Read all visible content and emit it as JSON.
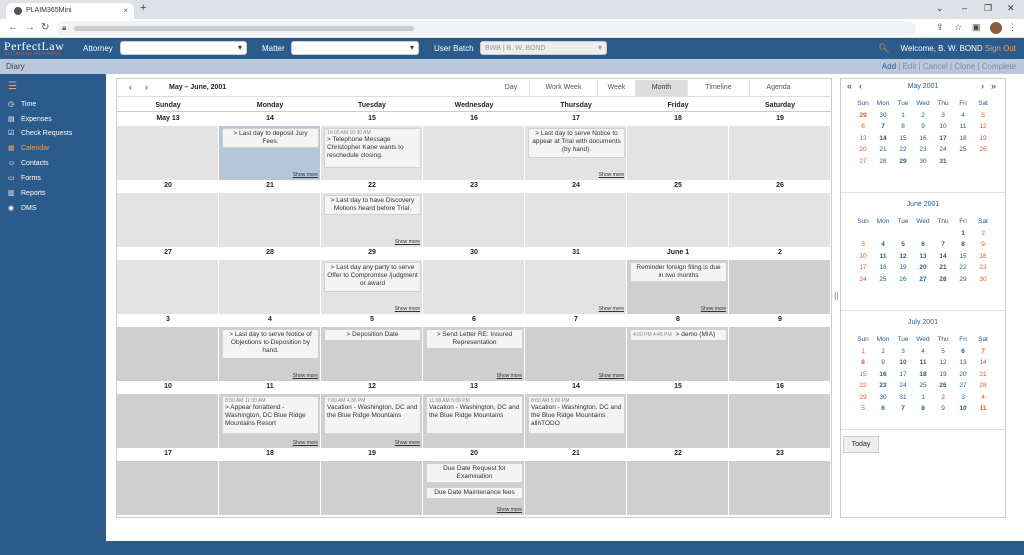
{
  "browser": {
    "tab_title": "PLAIM365Mini",
    "new_tab": "+",
    "close": "×"
  },
  "header": {
    "logo_main": "PerfectLaw",
    "logo_sub": "ALL-IN-ONE SOFTWARE",
    "attorney_label": "Attorney",
    "matter_label": "Matter",
    "user_batch_label": "User Batch",
    "user_batch_value": "BWB | B. W. BOND",
    "welcome": "Welcome, B. W. BOND",
    "sign_out": "Sign Out"
  },
  "subbar": {
    "title": "Diary",
    "actions": [
      "Add",
      "Edit",
      "Cancel",
      "Clone",
      "Complete"
    ]
  },
  "sidebar": {
    "items": [
      {
        "label": "Time",
        "icon": "clock-icon"
      },
      {
        "label": "Expenses",
        "icon": "expenses-icon"
      },
      {
        "label": "Check Requests",
        "icon": "check-icon"
      },
      {
        "label": "Calendar",
        "icon": "calendar-icon",
        "active": true
      },
      {
        "label": "Contacts",
        "icon": "contacts-icon"
      },
      {
        "label": "Forms",
        "icon": "forms-icon"
      },
      {
        "label": "Reports",
        "icon": "reports-icon"
      },
      {
        "label": "DMS",
        "icon": "dms-icon"
      }
    ]
  },
  "calendar": {
    "range": "May – June, 2001",
    "views": [
      "Day",
      "Work Week",
      "Week",
      "Month",
      "Timeline",
      "Agenda"
    ],
    "selected_view": "Month",
    "weekdays": [
      "Sunday",
      "Monday",
      "Tuesday",
      "Wednesday",
      "Thursday",
      "Friday",
      "Saturday"
    ],
    "show_more": "Show more",
    "weeks": [
      {
        "days": [
          "May 13",
          "14",
          "15",
          "16",
          "17",
          "18",
          "19"
        ]
      },
      {
        "days": [
          "20",
          "21",
          "22",
          "23",
          "24",
          "25",
          "26"
        ]
      },
      {
        "days": [
          "27",
          "28",
          "29",
          "30",
          "31",
          "June 1",
          "2"
        ]
      },
      {
        "days": [
          "3",
          "4",
          "5",
          "6",
          "7",
          "8",
          "9"
        ]
      },
      {
        "days": [
          "10",
          "11",
          "12",
          "13",
          "14",
          "15",
          "16"
        ]
      },
      {
        "days": [
          "17",
          "18",
          "19",
          "20",
          "21",
          "22",
          "23"
        ]
      }
    ],
    "events": {
      "w0d1": "> Last day to deposit Jury Fees.",
      "w0d2_time": "10:00 AM  10:30 AM",
      "w0d2": "> Telephone Message Christopher Kane wants to reschedule closing.",
      "w0d4": "> Last day to serve Notice to appear at Trial with documents (by hand).",
      "w1d2": "> Last day to have Discovery Motions heard before Trial.",
      "w2d2": "> Last day any party to serve Offer to Compromise /judgment or award",
      "w2d5": "Reminder foreign filing is due in two months",
      "w3d1": "> Last day to serve Notice of Objections to Deposition by hand.",
      "w3d2": "> Deposition Date",
      "w3d3": "> Send Letter RE: Insured Representation",
      "w3d5_time": "4:00 PM  4:45 PM",
      "w3d5": "> demo (MIA)",
      "w4d1_time": "8:00 AM  11:00 AM",
      "w4d1": "> Appear for/attend - Washington, DC Blue Ridge Mountains Resort",
      "w4d2_time": "7:00 AM  4:30 PM",
      "w4d2": "Vacation - Washington, DC and the Blue Ridge Mountains",
      "w4d3_time": "11:00 AM  5:00 PM",
      "w4d3": "Vacation - Washington, DC and the Blue Ridge Mountains",
      "w4d4_time": "8:00 AM  5:00 PM",
      "w4d4": "Vacation - Washington, DC and the Blue Ridge Mountains allhTODO",
      "w5d3a": "Due Date Request for Examination",
      "w5d3b": "Due Date Maintenance fees"
    }
  },
  "mini_calendars": {
    "weekdays": [
      "Sun",
      "Mon",
      "Tue",
      "Wed",
      "Thu",
      "Fri",
      "Sat"
    ],
    "today_label": "Today",
    "nav": {
      "prev_year": "«",
      "prev": "‹",
      "next": "›",
      "next_year": "»"
    },
    "months": [
      {
        "title": "May 2001",
        "rows": [
          [
            "29",
            "30",
            "1",
            "2",
            "3",
            "4",
            "5"
          ],
          [
            "6",
            "7",
            "8",
            "9",
            "10",
            "11",
            "12"
          ],
          [
            "13",
            "14",
            "15",
            "16",
            "17",
            "18",
            "19"
          ],
          [
            "20",
            "21",
            "22",
            "23",
            "24",
            "25",
            "26"
          ],
          [
            "27",
            "28",
            "29",
            "30",
            "31",
            "",
            ""
          ]
        ]
      },
      {
        "title": "June 2001",
        "rows": [
          [
            "",
            "",
            "",
            "",
            "",
            "1",
            "2"
          ],
          [
            "3",
            "4",
            "5",
            "6",
            "7",
            "8",
            "9"
          ],
          [
            "10",
            "11",
            "12",
            "13",
            "14",
            "15",
            "16"
          ],
          [
            "17",
            "18",
            "19",
            "20",
            "21",
            "22",
            "23"
          ],
          [
            "24",
            "25",
            "26",
            "27",
            "28",
            "29",
            "30"
          ]
        ]
      },
      {
        "title": "July 2001",
        "rows": [
          [
            "1",
            "2",
            "3",
            "4",
            "5",
            "6",
            "7"
          ],
          [
            "8",
            "9",
            "10",
            "11",
            "12",
            "13",
            "14"
          ],
          [
            "15",
            "16",
            "17",
            "18",
            "19",
            "20",
            "21"
          ],
          [
            "22",
            "23",
            "24",
            "25",
            "26",
            "27",
            "28"
          ],
          [
            "29",
            "30",
            "31",
            "1",
            "2",
            "3",
            "4"
          ],
          [
            "5",
            "6",
            "7",
            "8",
            "9",
            "10",
            "11"
          ]
        ]
      }
    ]
  },
  "colors": {
    "brand": "#2b5b8a",
    "accent": "#e05a2a"
  }
}
